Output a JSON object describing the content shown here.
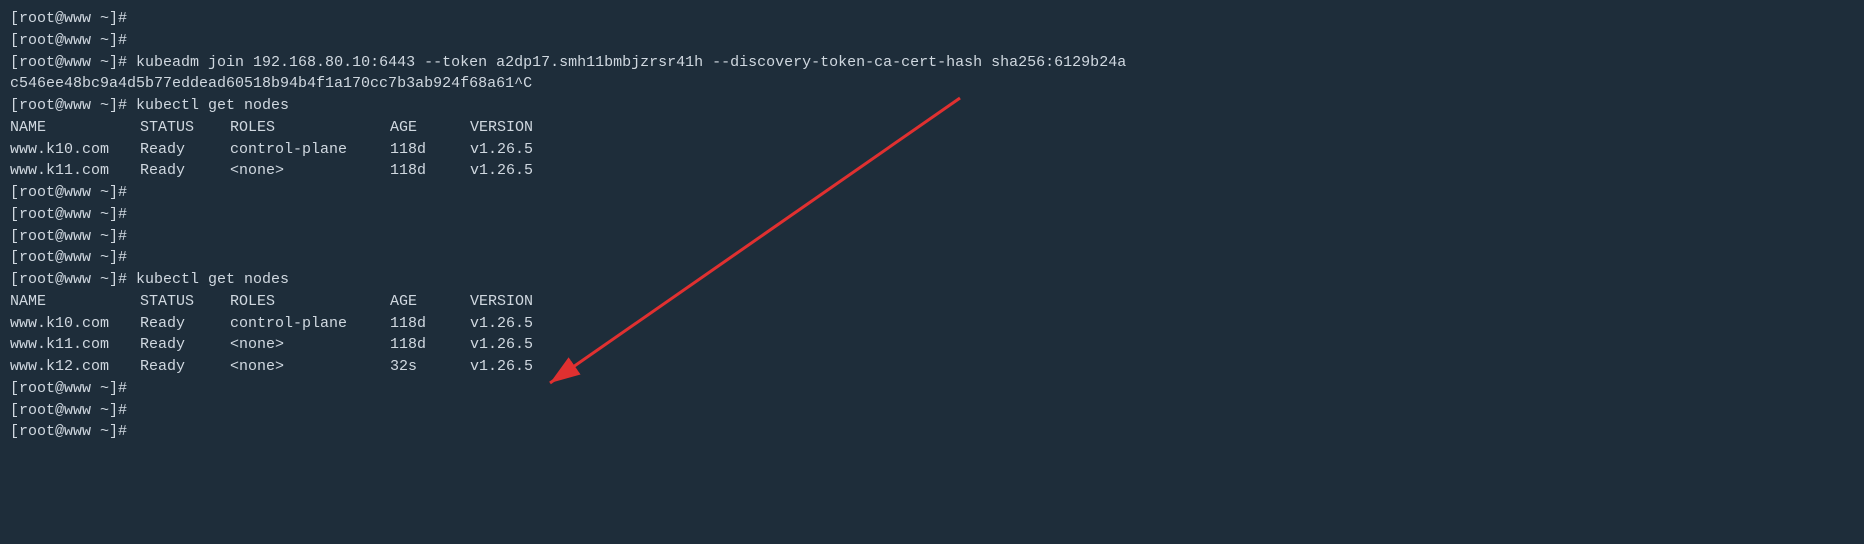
{
  "terminal": {
    "bg": "#1e2d3a",
    "lines": [
      {
        "type": "prompt",
        "text": "[root@www ~]#"
      },
      {
        "type": "prompt",
        "text": "[root@www ~]#"
      },
      {
        "type": "cmd",
        "text": "[root@www ~]# kubeadm join 192.168.80.10:6443 --token a2dp17.smh11bmbjzrsr41h --discovery-token-ca-cert-hash sha256:6129b24a"
      },
      {
        "type": "cont",
        "text": "c546ee48bc9a4d5b77eddead60518b94b4f1a170cc7b3ab924f68a61^C"
      },
      {
        "type": "cmd",
        "text": "[root@www ~]# kubectl get nodes"
      },
      {
        "type": "header",
        "cols": [
          "NAME",
          "STATUS",
          "ROLES",
          "AGE",
          "VERSION"
        ]
      },
      {
        "type": "node",
        "cols": [
          "www.k10.com",
          "Ready",
          "control-plane",
          "118d",
          "v1.26.5"
        ]
      },
      {
        "type": "node",
        "cols": [
          "www.k11.com",
          "Ready",
          "<none>",
          "118d",
          "v1.26.5"
        ]
      },
      {
        "type": "prompt",
        "text": "[root@www ~]#"
      },
      {
        "type": "prompt",
        "text": "[root@www ~]#"
      },
      {
        "type": "prompt",
        "text": "[root@www ~]#"
      },
      {
        "type": "prompt",
        "text": "[root@www ~]#"
      },
      {
        "type": "cmd",
        "text": "[root@www ~]# kubectl get nodes"
      },
      {
        "type": "header",
        "cols": [
          "NAME",
          "STATUS",
          "ROLES",
          "AGE",
          "VERSION"
        ]
      },
      {
        "type": "node",
        "cols": [
          "www.k10.com",
          "Ready",
          "control-plane",
          "118d",
          "v1.26.5"
        ]
      },
      {
        "type": "node",
        "cols": [
          "www.k11.com",
          "Ready",
          "<none>",
          "118d",
          "v1.26.5"
        ]
      },
      {
        "type": "node",
        "cols": [
          "www.k12.com",
          "Ready",
          "<none>",
          "32s",
          "v1.26.5"
        ]
      },
      {
        "type": "prompt",
        "text": "[root@www ~]#"
      },
      {
        "type": "prompt",
        "text": "[root@www ~]#"
      },
      {
        "type": "prompt",
        "text": "[root@www ~]#"
      }
    ]
  }
}
